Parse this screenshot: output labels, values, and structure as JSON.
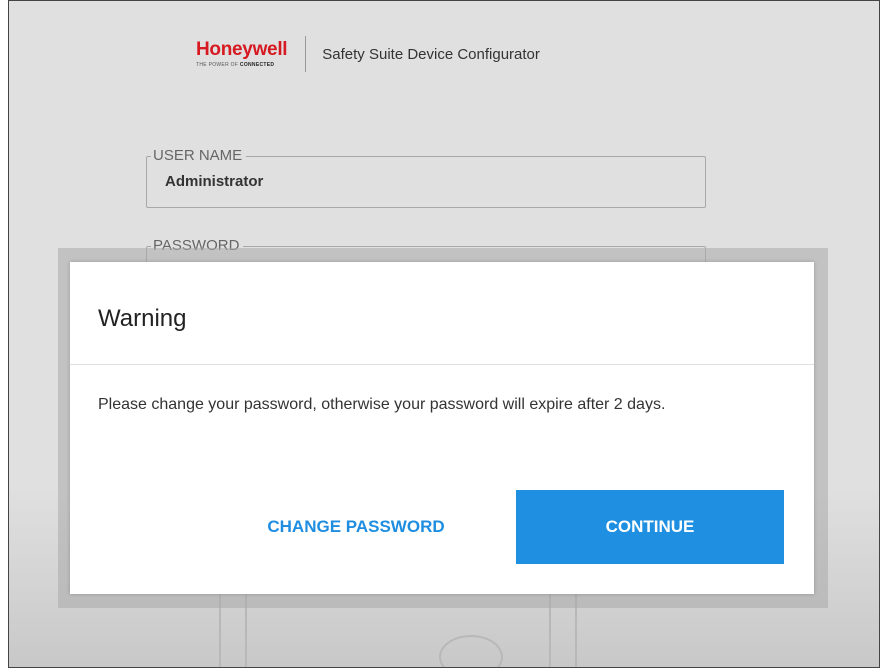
{
  "header": {
    "brand": "Honeywell",
    "tagline_prefix": "THE POWER OF ",
    "tagline_bold": "CONNECTED",
    "app_title": "Safety Suite Device Configurator"
  },
  "login": {
    "username_label": "USER NAME",
    "username_value": "Administrator",
    "password_label": "PASSWORD"
  },
  "dialog": {
    "title": "Warning",
    "message": "Please change your password, otherwise your password will expire after 2 days.",
    "change_password_label": "CHANGE PASSWORD",
    "continue_label": "CONTINUE"
  },
  "colors": {
    "brand_red": "#d71921",
    "accent_blue": "#1e8fe1"
  }
}
